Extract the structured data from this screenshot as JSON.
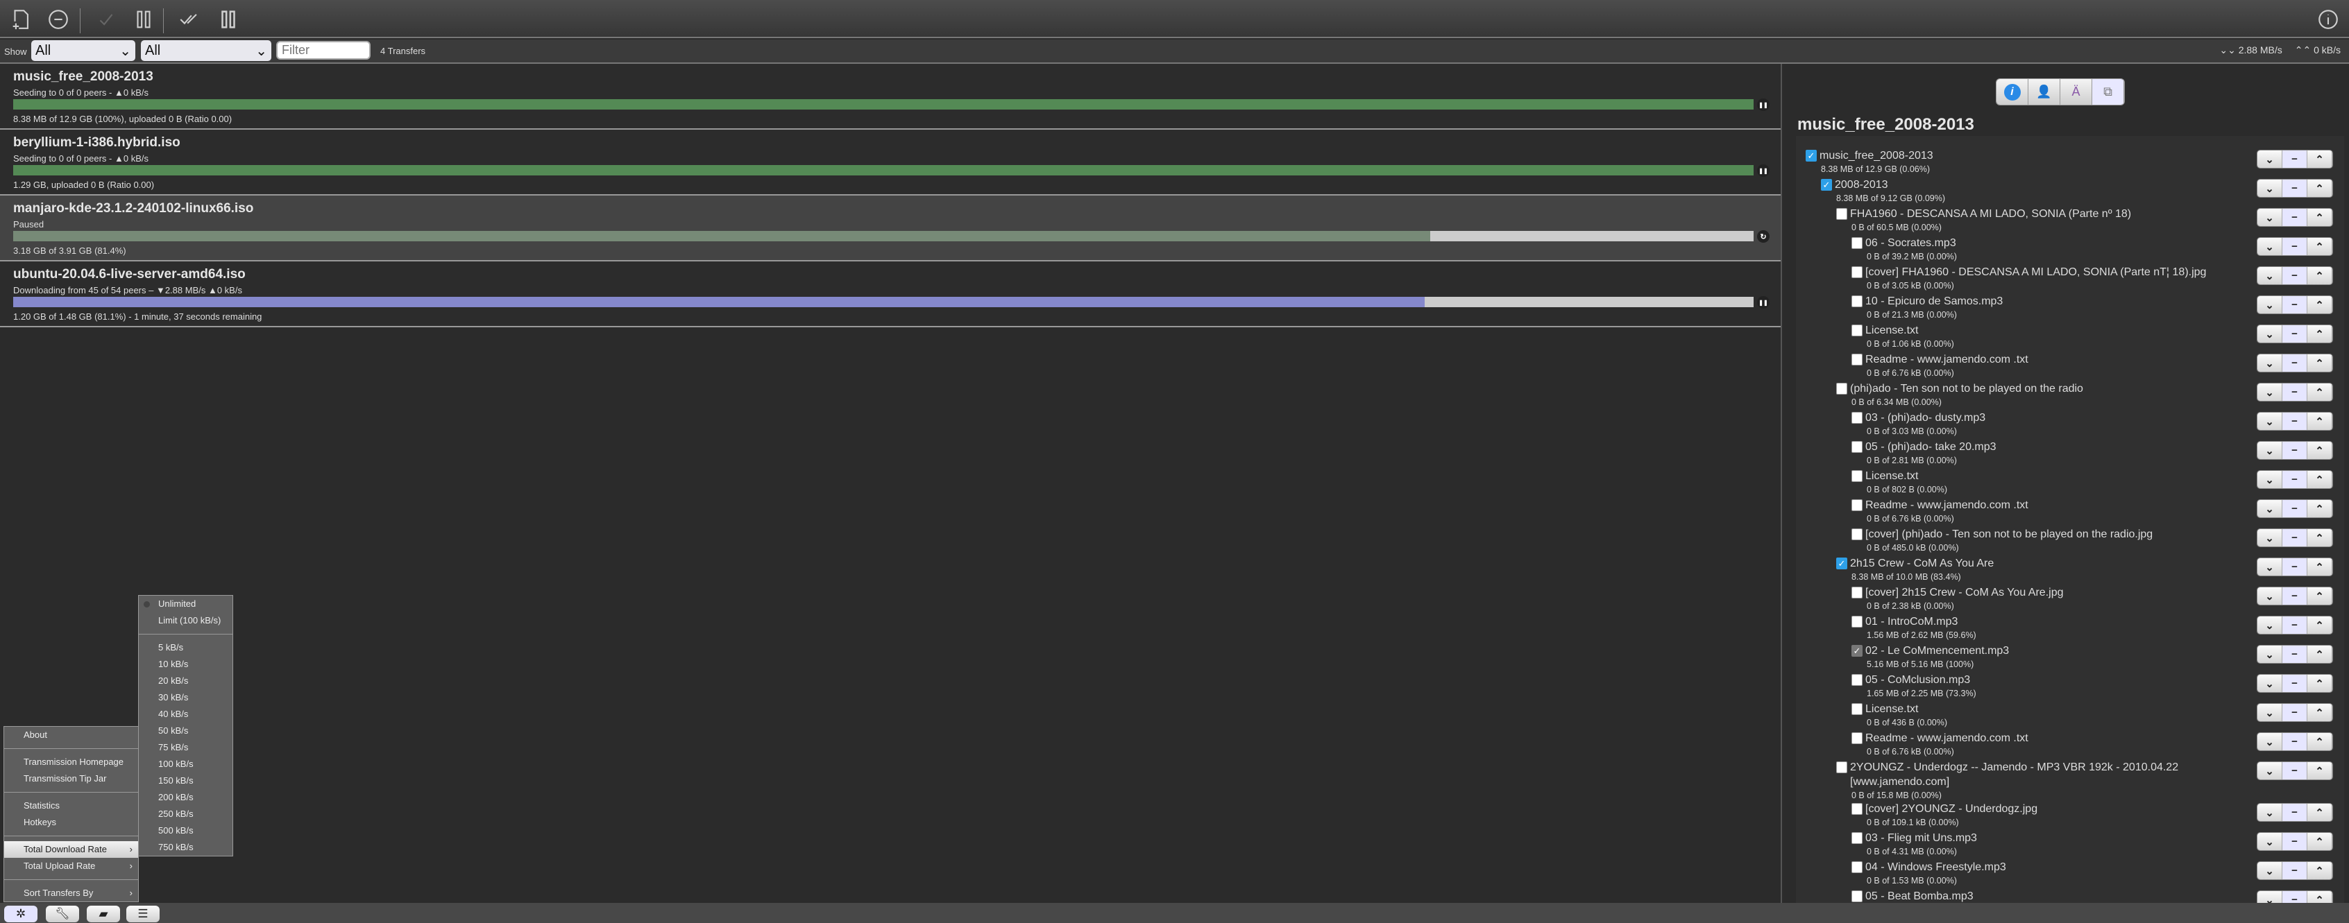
{
  "toolbar": {
    "buttons": [
      {
        "icon": "open-file-icon",
        "label": "Open"
      },
      {
        "icon": "remove-icon",
        "label": "Remove"
      },
      {
        "icon": "start-icon",
        "label": "Start"
      },
      {
        "icon": "pause-icon",
        "label": "Pause"
      },
      {
        "icon": "start-all-icon",
        "label": "Start All"
      },
      {
        "icon": "pause-all-icon",
        "label": "Pause All"
      },
      {
        "icon": "info-icon",
        "label": "Inspector"
      }
    ]
  },
  "filterbar": {
    "show_label": "Show",
    "status_filter": "All",
    "tracker_filter": "All",
    "filter_placeholder": "Filter",
    "count": "4 Transfers",
    "download_rate": "2.88 MB/s",
    "upload_rate": "0 kB/s"
  },
  "torrents": [
    {
      "name": "music_free_2008-2013",
      "peers": "Seeding to 0 of 0 peers - ▲0 kB/s",
      "stats": "8.38 MB of 12.9 GB (100%), uploaded 0 B (Ratio 0.00)",
      "progress": 100,
      "color": "#548a55",
      "action": "pause"
    },
    {
      "name": "beryllium-1-i386.hybrid.iso",
      "peers": "Seeding to 0 of 0 peers - ▲0 kB/s",
      "stats": "1.29 GB, uploaded 0 B (Ratio 0.00)",
      "progress": 100,
      "color": "#548a55",
      "action": "pause"
    },
    {
      "name": "manjaro-kde-23.1.2-240102-linux66.iso",
      "peers": "Paused",
      "stats": "3.18 GB of 3.91 GB (81.4%)",
      "progress": 81.4,
      "color": "#778a77",
      "action": "resume"
    },
    {
      "name": "ubuntu-20.04.6-live-server-amd64.iso",
      "peers": "Downloading from 45 of 54 peers – ▼2.88 MB/s ▲0 kB/s",
      "stats": "1.20 GB of 1.48 GB (81.1%) - 1 minute, 37 seconds remaining",
      "progress": 81.1,
      "color": "#8588cc",
      "action": "pause"
    }
  ],
  "inspector": {
    "tabs": [
      "info",
      "peers",
      "trackers",
      "files"
    ],
    "active_tab": "files",
    "title": "music_free_2008-2013",
    "files": [
      {
        "d": 0,
        "c": "on",
        "name": "music_free_2008-2013",
        "stat": "8.38 MB of 12.9 GB (0.06%)"
      },
      {
        "d": 1,
        "c": "on",
        "name": "2008-2013",
        "stat": "8.38 MB of 9.12 GB (0.09%)"
      },
      {
        "d": 2,
        "c": "off",
        "name": "FHA1960 - DESCANSA A MI LADO, SONIA (Parte nº 18)",
        "stat": "0 B of 60.5 MB (0.00%)"
      },
      {
        "d": 3,
        "c": "off",
        "name": "06 - Socrates.mp3",
        "stat": "0 B of 39.2 MB (0.00%)"
      },
      {
        "d": 3,
        "c": "off",
        "name": "[cover] FHA1960 - DESCANSA A MI LADO, SONIA (Parte nT¦ 18).jpg",
        "stat": "0 B of 3.05 kB (0.00%)"
      },
      {
        "d": 3,
        "c": "off",
        "name": "10 - Epicuro de Samos.mp3",
        "stat": "0 B of 21.3 MB (0.00%)"
      },
      {
        "d": 3,
        "c": "off",
        "name": "License.txt",
        "stat": "0 B of 1.06 kB (0.00%)"
      },
      {
        "d": 3,
        "c": "off",
        "name": "Readme - www.jamendo.com .txt",
        "stat": "0 B of 6.76 kB (0.00%)"
      },
      {
        "d": 2,
        "c": "off",
        "name": "(phi)ado - Ten son not to be played on the radio",
        "stat": "0 B of 6.34 MB (0.00%)"
      },
      {
        "d": 3,
        "c": "off",
        "name": "03 - (phi)ado- dusty.mp3",
        "stat": "0 B of 3.03 MB (0.00%)"
      },
      {
        "d": 3,
        "c": "off",
        "name": "05 - (phi)ado- take 20.mp3",
        "stat": "0 B of 2.81 MB (0.00%)"
      },
      {
        "d": 3,
        "c": "off",
        "name": "License.txt",
        "stat": "0 B of 802 B (0.00%)"
      },
      {
        "d": 3,
        "c": "off",
        "name": "Readme - www.jamendo.com .txt",
        "stat": "0 B of 6.76 kB (0.00%)"
      },
      {
        "d": 3,
        "c": "off",
        "name": "[cover] (phi)ado - Ten son not to be played on the radio.jpg",
        "stat": "0 B of 485.0 kB (0.00%)"
      },
      {
        "d": 2,
        "c": "on",
        "name": "2h15 Crew - CoM As You Are",
        "stat": "8.38 MB of 10.0 MB (83.4%)"
      },
      {
        "d": 3,
        "c": "off",
        "name": "[cover] 2h15 Crew - CoM As You Are.jpg",
        "stat": "0 B of 2.38 kB (0.00%)"
      },
      {
        "d": 3,
        "c": "off",
        "name": "01 - IntroCoM.mp3",
        "stat": "1.56 MB of 2.62 MB (59.6%)"
      },
      {
        "d": 3,
        "c": "grey",
        "name": "02 - Le CoMmencement.mp3",
        "stat": "5.16 MB of 5.16 MB (100%)"
      },
      {
        "d": 3,
        "c": "off",
        "name": "05 - CoMclusion.mp3",
        "stat": "1.65 MB of 2.25 MB (73.3%)"
      },
      {
        "d": 3,
        "c": "off",
        "name": "License.txt",
        "stat": "0 B of 436 B (0.00%)"
      },
      {
        "d": 3,
        "c": "off",
        "name": "Readme - www.jamendo.com .txt",
        "stat": "0 B of 6.76 kB (0.00%)"
      },
      {
        "d": 2,
        "c": "off",
        "name": "2YOUNGZ - Underdogz -- Jamendo - MP3 VBR 192k - 2010.04.22 [www.jamendo.com]",
        "stat": "0 B of 15.8 MB (0.00%)"
      },
      {
        "d": 3,
        "c": "off",
        "name": "[cover] 2YOUNGZ - Underdogz.jpg",
        "stat": "0 B of 109.1 kB (0.00%)"
      },
      {
        "d": 3,
        "c": "off",
        "name": "03 - Flieg mit Uns.mp3",
        "stat": "0 B of 4.31 MB (0.00%)"
      },
      {
        "d": 3,
        "c": "off",
        "name": "04 - Windows Freestyle.mp3",
        "stat": "0 B of 1.53 MB (0.00%)"
      },
      {
        "d": 3,
        "c": "off",
        "name": "05 - Beat Bomba.mp3",
        "stat": ""
      }
    ]
  },
  "main_menu": [
    [
      "About"
    ],
    [
      "Transmission Homepage",
      "Transmission Tip Jar"
    ],
    [
      "Statistics",
      "Hotkeys"
    ],
    [
      "Total Download Rate",
      "Total Upload Rate"
    ],
    [
      "Sort Transfers By"
    ]
  ],
  "main_menu_highlight": "Total Download Rate",
  "submenus": [
    "Total Download Rate",
    "Total Upload Rate",
    "Sort Transfers By"
  ],
  "rate_menu": {
    "unlimited": "Unlimited",
    "limit": "Limit (100 kB/s)",
    "selected": "Unlimited",
    "rates": [
      "5 kB/s",
      "10 kB/s",
      "20 kB/s",
      "30 kB/s",
      "40 kB/s",
      "50 kB/s",
      "75 kB/s",
      "100 kB/s",
      "150 kB/s",
      "200 kB/s",
      "250 kB/s",
      "500 kB/s",
      "750 kB/s"
    ]
  },
  "bottombar": [
    {
      "icon": "gear-icon",
      "active": true
    },
    {
      "icon": "wrench-icon"
    },
    {
      "icon": "turtle-icon"
    },
    {
      "icon": "compact-view-icon"
    }
  ]
}
